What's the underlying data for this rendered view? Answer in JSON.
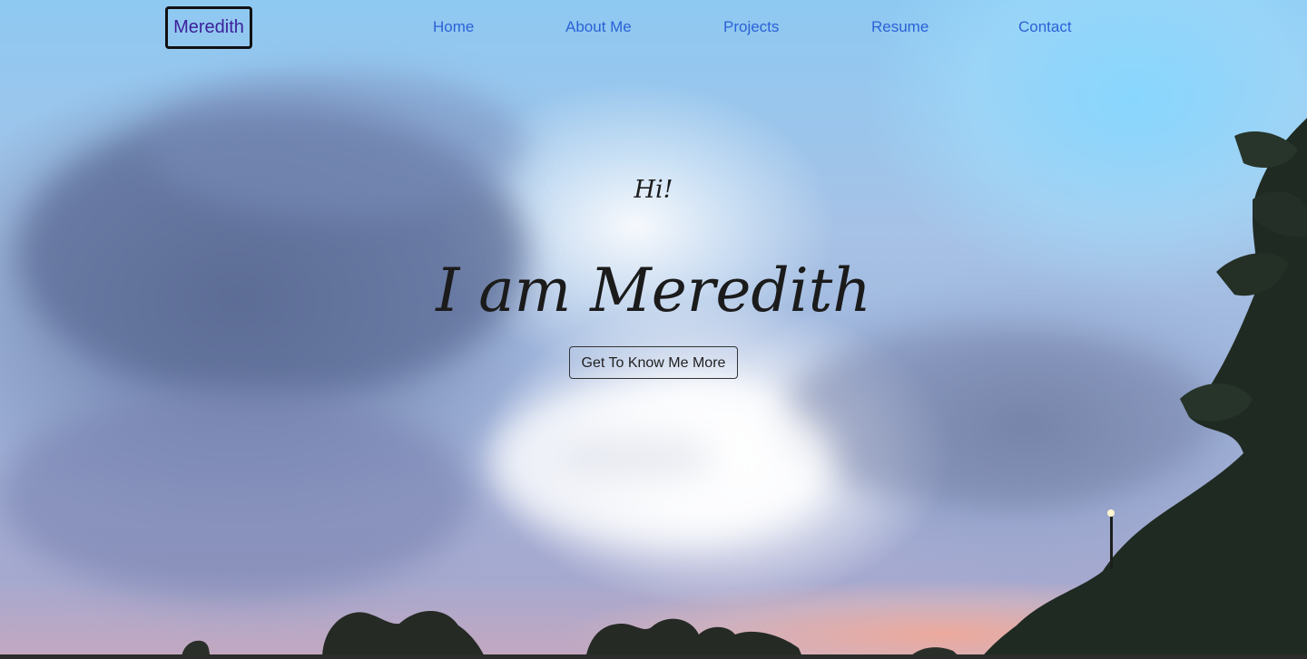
{
  "nav": {
    "brand": "Meredith",
    "links": [
      {
        "label": "Home"
      },
      {
        "label": "About Me"
      },
      {
        "label": "Projects"
      },
      {
        "label": "Resume"
      },
      {
        "label": "Contact"
      }
    ]
  },
  "hero": {
    "greeting": "Hi!",
    "headline": "I am Meredith",
    "cta_label": "Get To Know Me More",
    "background": "sunset-sky-photo"
  },
  "colors": {
    "brand_text": "#3b1f9a",
    "nav_link": "#2b62d6",
    "heading_text": "#1b1b1b"
  }
}
